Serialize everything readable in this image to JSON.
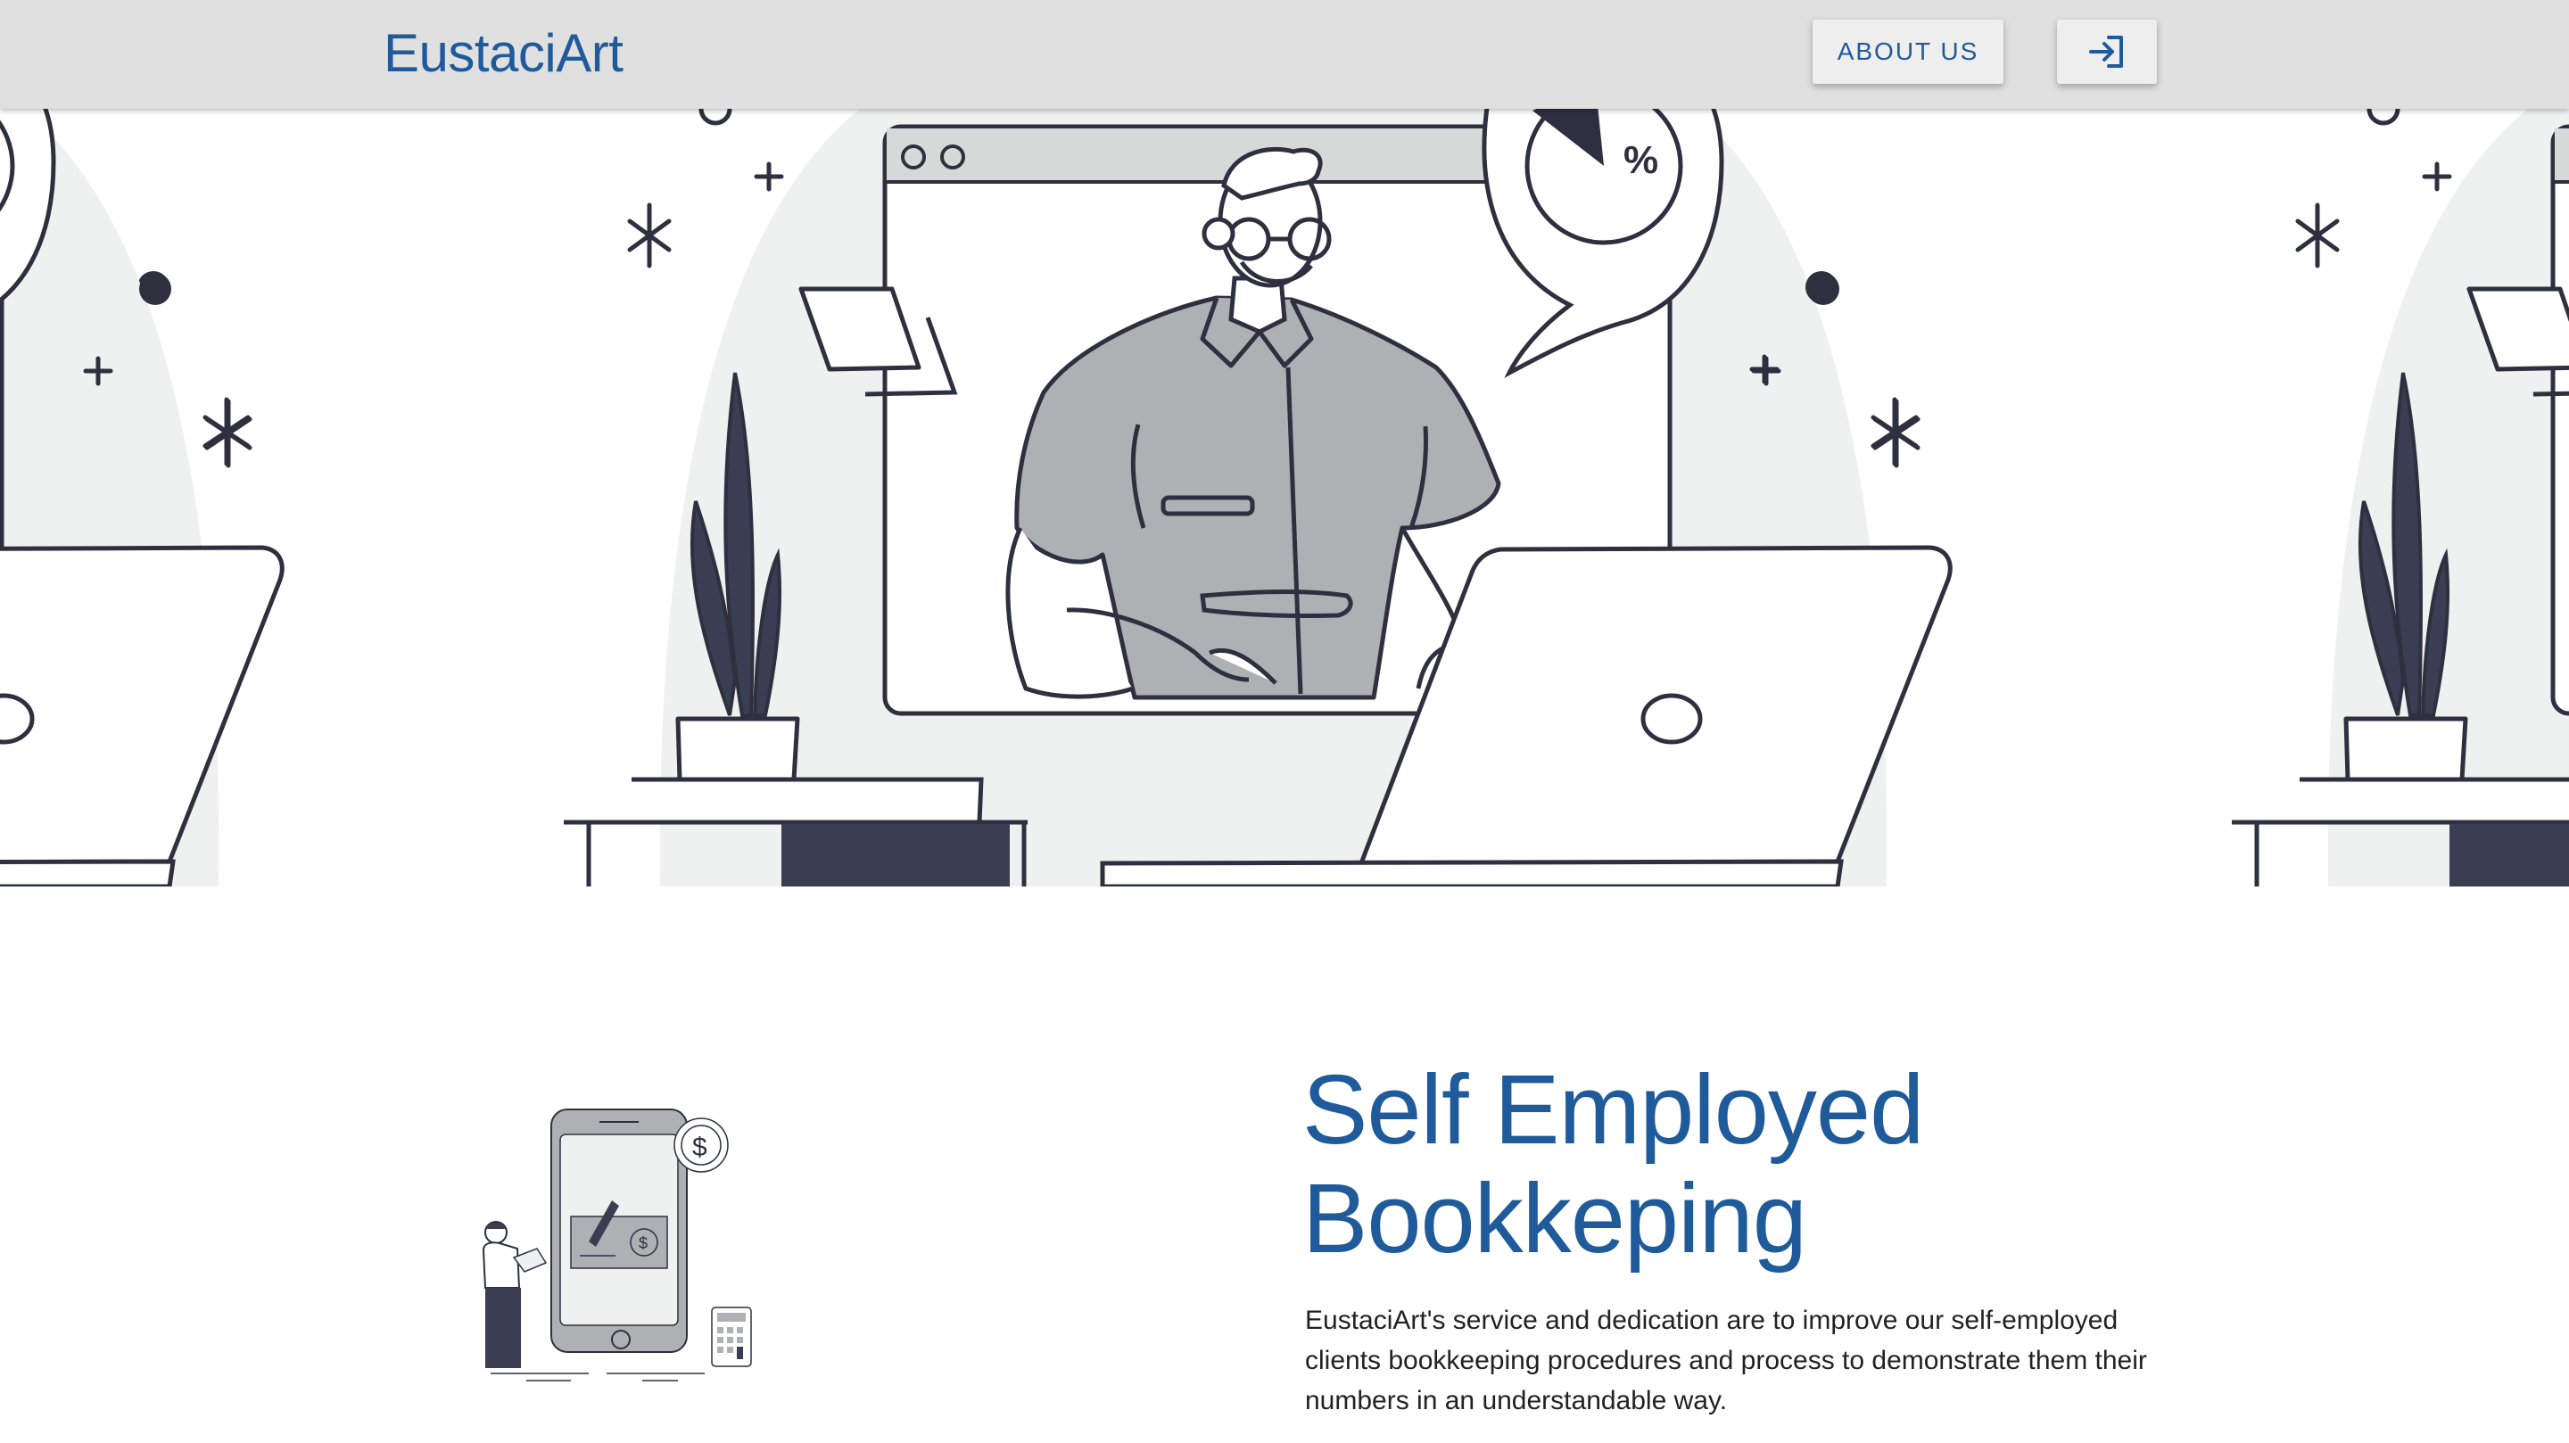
{
  "header": {
    "brand": "EustaciArt",
    "about_label": "ABOUT US",
    "login_icon": "login-arrow-icon"
  },
  "hero": {
    "illustration": "man-at-laptop-illustration",
    "percent_symbol": "%"
  },
  "section": {
    "title_line1": "Self Employed",
    "title_line2": "Bookkeping",
    "description": "EustaciArt's service and dedication are to improve our self-employed clients bookkeeping procedures and process to demonstrate them their numbers in an understandable way.",
    "illustration": "mobile-check-payment-illustration",
    "currency_symbol": "$"
  },
  "colors": {
    "brand": "#1f5a9b",
    "topbar": "#e0e0e0",
    "ink": "#2e3040",
    "shirt": "#adb1b4",
    "blob": "#eef1ef",
    "dark_fill": "#3b3d52"
  }
}
